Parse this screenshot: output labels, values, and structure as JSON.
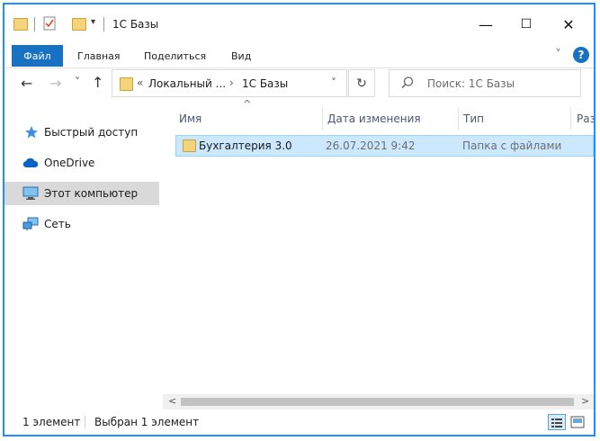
{
  "window": {
    "title": "1С Базы",
    "minimize_glyph": "—",
    "maximize_glyph": "☐",
    "close_glyph": "✕"
  },
  "ribbon": {
    "tabs": [
      {
        "label": "Файл"
      },
      {
        "label": "Главная"
      },
      {
        "label": "Поделиться"
      },
      {
        "label": "Вид"
      }
    ],
    "help_glyph": "?",
    "expand_glyph": "˅"
  },
  "nav": {
    "back_glyph": "←",
    "forward_glyph": "→",
    "recent_glyph": "˅",
    "up_glyph": "↑",
    "breadcrumb_overflow": "«",
    "breadcrumb_parent": "Локальный ...",
    "breadcrumb_sep": "›",
    "breadcrumb_current": "1С Базы",
    "address_dropdown_glyph": "˅",
    "refresh_glyph": "↻",
    "search_placeholder": "Поиск: 1С Базы"
  },
  "sidebar": {
    "items": [
      {
        "label": "Быстрый доступ",
        "icon": "star-icon"
      },
      {
        "label": "OneDrive",
        "icon": "cloud-icon"
      },
      {
        "label": "Этот компьютер",
        "icon": "computer-icon",
        "selected": true
      },
      {
        "label": "Сеть",
        "icon": "network-icon"
      }
    ]
  },
  "columns": {
    "sort_glyph": "^",
    "name": "Имя",
    "date": "Дата изменения",
    "type": "Тип",
    "size": "Раз"
  },
  "files": [
    {
      "name": "Бухгалтерия 3.0",
      "date": "26.07.2021 9:42",
      "type": "Папка с файлами"
    }
  ],
  "status": {
    "count": "1 элемент",
    "selected": "Выбран 1 элемент"
  },
  "scroll": {
    "left_glyph": "<",
    "right_glyph": ">"
  },
  "colors": {
    "accent": "#1971c2",
    "frame": "#1e90ff",
    "selection": "#cce8ff",
    "folder": "#f5d37a"
  }
}
